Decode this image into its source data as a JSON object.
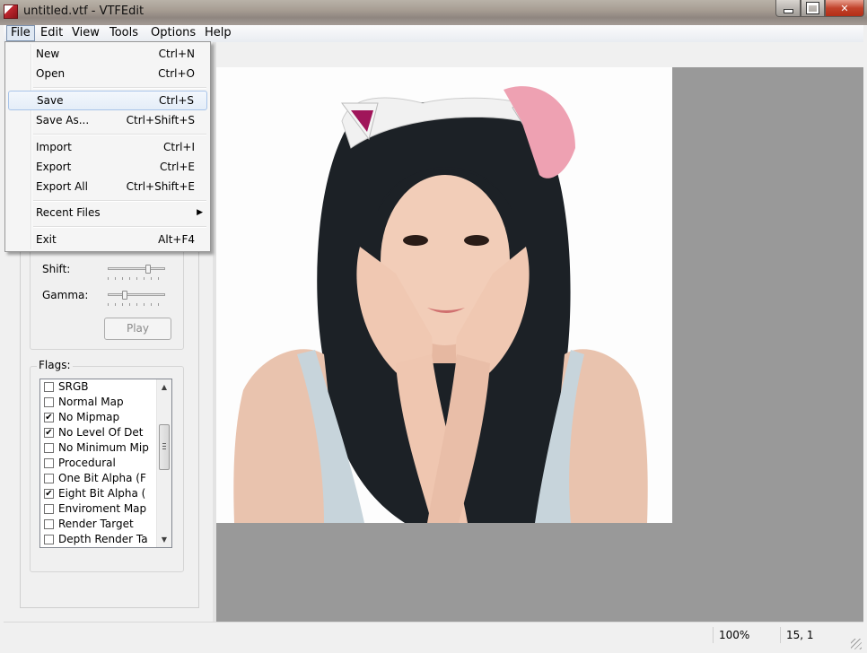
{
  "window": {
    "title": "untitled.vtf - VTFEdit",
    "icon": "vtfedit-app-icon"
  },
  "menubar": [
    {
      "label": "File"
    },
    {
      "label": "Edit"
    },
    {
      "label": "View"
    },
    {
      "label": "Tools"
    },
    {
      "label": "Options"
    },
    {
      "label": "Help"
    }
  ],
  "file_menu": {
    "items": [
      {
        "label": "New",
        "shortcut": "Ctrl+N"
      },
      {
        "label": "Open",
        "shortcut": "Ctrl+O"
      },
      {
        "label": "Save",
        "shortcut": "Ctrl+S",
        "highlighted": true
      },
      {
        "label": "Save As...",
        "shortcut": "Ctrl+Shift+S"
      },
      {
        "label": "Import",
        "shortcut": "Ctrl+I"
      },
      {
        "label": "Export",
        "shortcut": "Ctrl+E"
      },
      {
        "label": "Export All",
        "shortcut": "Ctrl+Shift+E"
      },
      {
        "label": "Recent Files",
        "submenu": true
      },
      {
        "label": "Exit",
        "shortcut": "Alt+F4"
      }
    ]
  },
  "controls": {
    "shift_label": "Shift:",
    "gamma_label": "Gamma:",
    "shift_value": 0.75,
    "gamma_value": 0.3,
    "play_label": "Play"
  },
  "flags": {
    "title": "Flags:",
    "items": [
      {
        "label": "SRGB",
        "checked": false
      },
      {
        "label": "Normal Map",
        "checked": false
      },
      {
        "label": "No Mipmap",
        "checked": true
      },
      {
        "label": "No Level Of Det",
        "checked": true
      },
      {
        "label": "No Minimum Mip",
        "checked": false
      },
      {
        "label": "Procedural",
        "checked": false
      },
      {
        "label": "One Bit Alpha (F",
        "checked": false
      },
      {
        "label": "Eight Bit Alpha (",
        "checked": true
      },
      {
        "label": "Enviroment Map",
        "checked": false
      },
      {
        "label": "Render Target",
        "checked": false
      },
      {
        "label": "Depth Render Ta",
        "checked": false
      }
    ]
  },
  "statusbar": {
    "zoom": "100%",
    "coords": "15, 1"
  },
  "colors": {
    "canvas_bg": "#999999",
    "menu_highlight": "#e4edf8",
    "close_button": "#c2432b"
  }
}
